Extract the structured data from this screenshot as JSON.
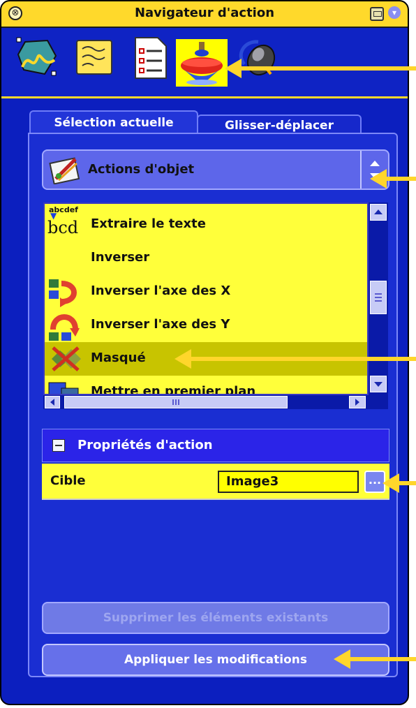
{
  "window": {
    "title": "Navigateur d'action"
  },
  "toolbar": {
    "icons": [
      "signature-icon",
      "sticky-note-icon",
      "checklist-icon",
      "spinning-top-icon",
      "mouse-icon"
    ],
    "active_index": 3
  },
  "tabs": [
    {
      "label": "Sélection actuelle",
      "active": true
    },
    {
      "label": "Glisser-déplacer",
      "active": false
    }
  ],
  "category_select": {
    "value": "Actions d'objet",
    "icon": "object-actions-icon"
  },
  "actions_list": {
    "items": [
      {
        "label": "Extraire le texte",
        "icon": "extract-text-icon",
        "selected": false
      },
      {
        "label": "Inverser",
        "icon": "",
        "selected": false
      },
      {
        "label": "Inverser l'axe des X",
        "icon": "flip-x-icon",
        "selected": false
      },
      {
        "label": "Inverser l'axe des Y",
        "icon": "flip-y-icon",
        "selected": false
      },
      {
        "label": "Masqué",
        "icon": "hidden-icon",
        "selected": true
      },
      {
        "label": "Mettre en premier plan",
        "icon": "bring-to-front-icon",
        "selected": false
      }
    ],
    "icon_text": "abcdef"
  },
  "properties": {
    "header": "Propriétés d'action",
    "rows": [
      {
        "name": "Cible",
        "value": "Image3",
        "button": "..."
      }
    ]
  },
  "buttons": {
    "delete_existing": "Supprimer les éléments existants",
    "apply": "Appliquer les modifications"
  },
  "colors": {
    "panel_bg": "#0c1fbf",
    "title_bar": "#ffd92b",
    "list_bg": "#ffff3a",
    "selection": "#c8c400",
    "annotation_arrow": "#ffd62b"
  }
}
